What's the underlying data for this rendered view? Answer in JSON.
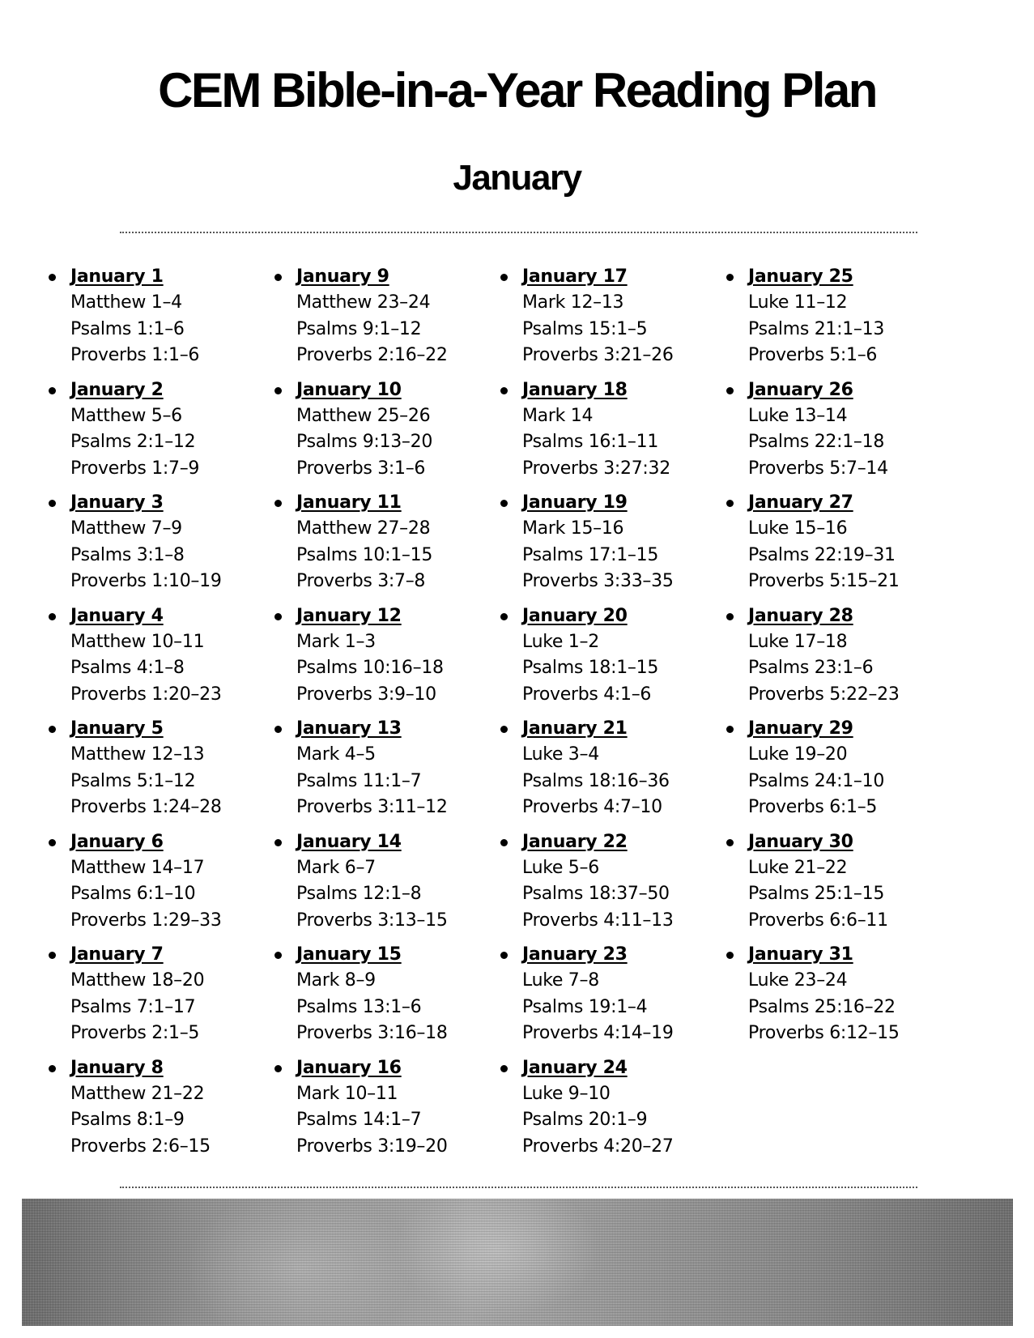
{
  "document": {
    "title": "CEM Bible-in-a-Year Reading Plan",
    "month": "January"
  },
  "columns": [
    {
      "days": [
        {
          "label": "January 1",
          "readings": [
            "Matthew 1–4",
            "Psalms 1:1–6",
            "Proverbs 1:1–6"
          ]
        },
        {
          "label": "January 2",
          "readings": [
            "Matthew 5–6",
            "Psalms 2:1–12",
            "Proverbs 1:7–9"
          ]
        },
        {
          "label": "January 3",
          "readings": [
            "Matthew 7–9",
            "Psalms 3:1–8",
            "Proverbs 1:10–19"
          ]
        },
        {
          "label": "January 4",
          "readings": [
            "Matthew 10–11",
            "Psalms 4:1–8",
            "Proverbs 1:20–23"
          ]
        },
        {
          "label": "January 5",
          "readings": [
            "Matthew 12–13",
            "Psalms 5:1–12",
            "Proverbs 1:24–28"
          ]
        },
        {
          "label": "January 6",
          "readings": [
            "Matthew 14–17",
            "Psalms 6:1–10",
            "Proverbs 1:29–33"
          ]
        },
        {
          "label": "January 7",
          "readings": [
            "Matthew 18–20",
            "Psalms 7:1–17",
            "Proverbs 2:1–5"
          ]
        },
        {
          "label": "January 8",
          "readings": [
            "Matthew 21–22",
            "Psalms 8:1–9",
            "Proverbs 2:6–15"
          ]
        }
      ]
    },
    {
      "days": [
        {
          "label": "January 9",
          "readings": [
            "Matthew 23–24",
            "Psalms 9:1–12",
            "Proverbs 2:16–22"
          ]
        },
        {
          "label": "January 10",
          "readings": [
            "Matthew 25–26",
            "Psalms 9:13–20",
            "Proverbs 3:1–6"
          ]
        },
        {
          "label": "January 11",
          "readings": [
            "Matthew 27–28",
            "Psalms 10:1–15",
            "Proverbs 3:7–8"
          ]
        },
        {
          "label": "January 12",
          "readings": [
            "Mark 1–3",
            "Psalms 10:16–18",
            "Proverbs 3:9–10"
          ]
        },
        {
          "label": "January 13",
          "readings": [
            "Mark 4–5",
            "Psalms 11:1–7",
            "Proverbs 3:11–12"
          ]
        },
        {
          "label": "January 14",
          "readings": [
            "Mark 6–7",
            "Psalms 12:1–8",
            "Proverbs 3:13–15"
          ]
        },
        {
          "label": "January 15",
          "readings": [
            "Mark 8–9",
            "Psalms 13:1–6",
            "Proverbs 3:16–18"
          ]
        },
        {
          "label": "January 16",
          "readings": [
            "Mark 10–11",
            "Psalms 14:1–7",
            "Proverbs 3:19–20"
          ]
        }
      ]
    },
    {
      "days": [
        {
          "label": "January 17",
          "readings": [
            "Mark 12–13",
            "Psalms 15:1–5",
            "Proverbs 3:21–26"
          ]
        },
        {
          "label": "January 18",
          "readings": [
            "Mark 14",
            "Psalms 16:1–11",
            "Proverbs 3:27:32"
          ]
        },
        {
          "label": "January 19",
          "readings": [
            "Mark 15–16",
            "Psalms 17:1–15",
            "Proverbs 3:33–35"
          ]
        },
        {
          "label": "January 20",
          "readings": [
            "Luke 1–2",
            "Psalms 18:1–15",
            "Proverbs 4:1–6"
          ]
        },
        {
          "label": "January 21",
          "readings": [
            "Luke 3–4",
            "Psalms 18:16–36",
            "Proverbs 4:7–10"
          ]
        },
        {
          "label": "January 22",
          "readings": [
            "Luke 5–6",
            "Psalms 18:37–50",
            "Proverbs 4:11–13"
          ]
        },
        {
          "label": "January 23",
          "readings": [
            "Luke 7–8",
            "Psalms 19:1–4",
            "Proverbs 4:14–19"
          ]
        },
        {
          "label": "January 24",
          "readings": [
            "Luke 9–10",
            "Psalms 20:1–9",
            "Proverbs 4:20–27"
          ]
        }
      ]
    },
    {
      "days": [
        {
          "label": "January 25",
          "readings": [
            "Luke 11–12",
            "Psalms 21:1–13",
            "Proverbs 5:1–6"
          ]
        },
        {
          "label": "January 26",
          "readings": [
            "Luke 13–14",
            "Psalms 22:1–18",
            "Proverbs 5:7–14"
          ]
        },
        {
          "label": "January 27",
          "readings": [
            "Luke 15–16",
            "Psalms 22:19–31",
            "Proverbs 5:15–21"
          ]
        },
        {
          "label": "January 28",
          "readings": [
            "Luke 17–18",
            "Psalms 23:1–6",
            "Proverbs 5:22–23"
          ]
        },
        {
          "label": "January 29",
          "readings": [
            "Luke 19–20",
            "Psalms 24:1–10",
            "Proverbs 6:1–5"
          ]
        },
        {
          "label": "January 30",
          "readings": [
            "Luke 21–22",
            "Psalms 25:1–15",
            "Proverbs 6:6–11"
          ]
        },
        {
          "label": "January 31",
          "readings": [
            "Luke 23–24",
            "Psalms 25:16–22",
            "Proverbs 6:12–15"
          ]
        }
      ]
    }
  ],
  "banner": {
    "description": "grayscale dithered photo banner"
  }
}
